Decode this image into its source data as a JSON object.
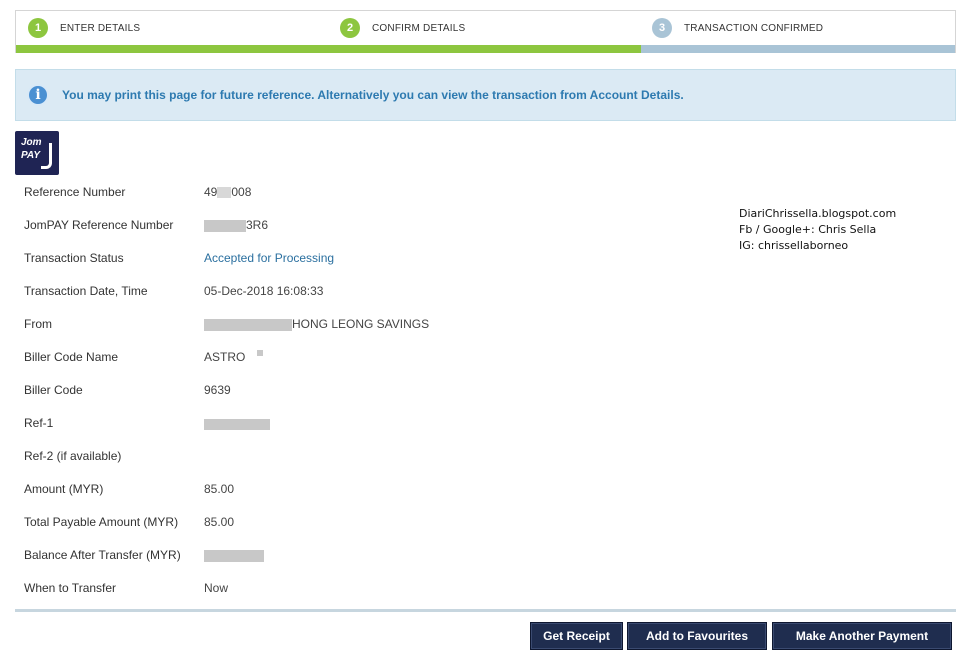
{
  "stepper": {
    "steps": [
      {
        "number": "1",
        "label": "ENTER DETAILS"
      },
      {
        "number": "2",
        "label": "CONFIRM DETAILS"
      },
      {
        "number": "3",
        "label": "TRANSACTION CONFIRMED"
      }
    ],
    "colors": {
      "done": "#8dc63f",
      "pending": "#a9c4d6"
    }
  },
  "info": {
    "icon": "info-icon",
    "message": "You may print this page for future reference. Alternatively you can view the transaction from Account Details."
  },
  "logo": {
    "line1": "Jom",
    "line2": "PAY"
  },
  "details": {
    "reference_number": {
      "label": "Reference Number",
      "value_prefix": "49",
      "value_suffix": "008"
    },
    "jompay_reference": {
      "label": "JomPAY Reference Number",
      "value_suffix": "3R6"
    },
    "transaction_status": {
      "label": "Transaction Status",
      "value": "Accepted for Processing"
    },
    "transaction_datetime": {
      "label": "Transaction Date, Time",
      "value": "05-Dec-2018 16:08:33"
    },
    "from": {
      "label": "From",
      "value_suffix": "HONG LEONG SAVINGS"
    },
    "biller_code_name": {
      "label": "Biller Code Name",
      "value": "ASTRO"
    },
    "biller_code": {
      "label": "Biller Code",
      "value": "9639"
    },
    "ref1": {
      "label": "Ref-1",
      "value": ""
    },
    "ref2": {
      "label": "Ref-2 (if available)",
      "value": ""
    },
    "amount": {
      "label": "Amount (MYR)",
      "value": "85.00"
    },
    "total_payable": {
      "label": "Total Payable Amount (MYR)",
      "value": "85.00"
    },
    "balance_after": {
      "label": "Balance After Transfer (MYR)",
      "value": ""
    },
    "when_to_transfer": {
      "label": "When to Transfer",
      "value": "Now"
    }
  },
  "watermark": {
    "line1": "DiariChrissella.blogspot.com",
    "line2": "Fb / Google+: Chris Sella",
    "line3": "IG: chrissellaborneo"
  },
  "buttons": {
    "get_receipt": "Get Receipt",
    "add_favourites": "Add to Favourites",
    "make_another": "Make Another Payment"
  }
}
